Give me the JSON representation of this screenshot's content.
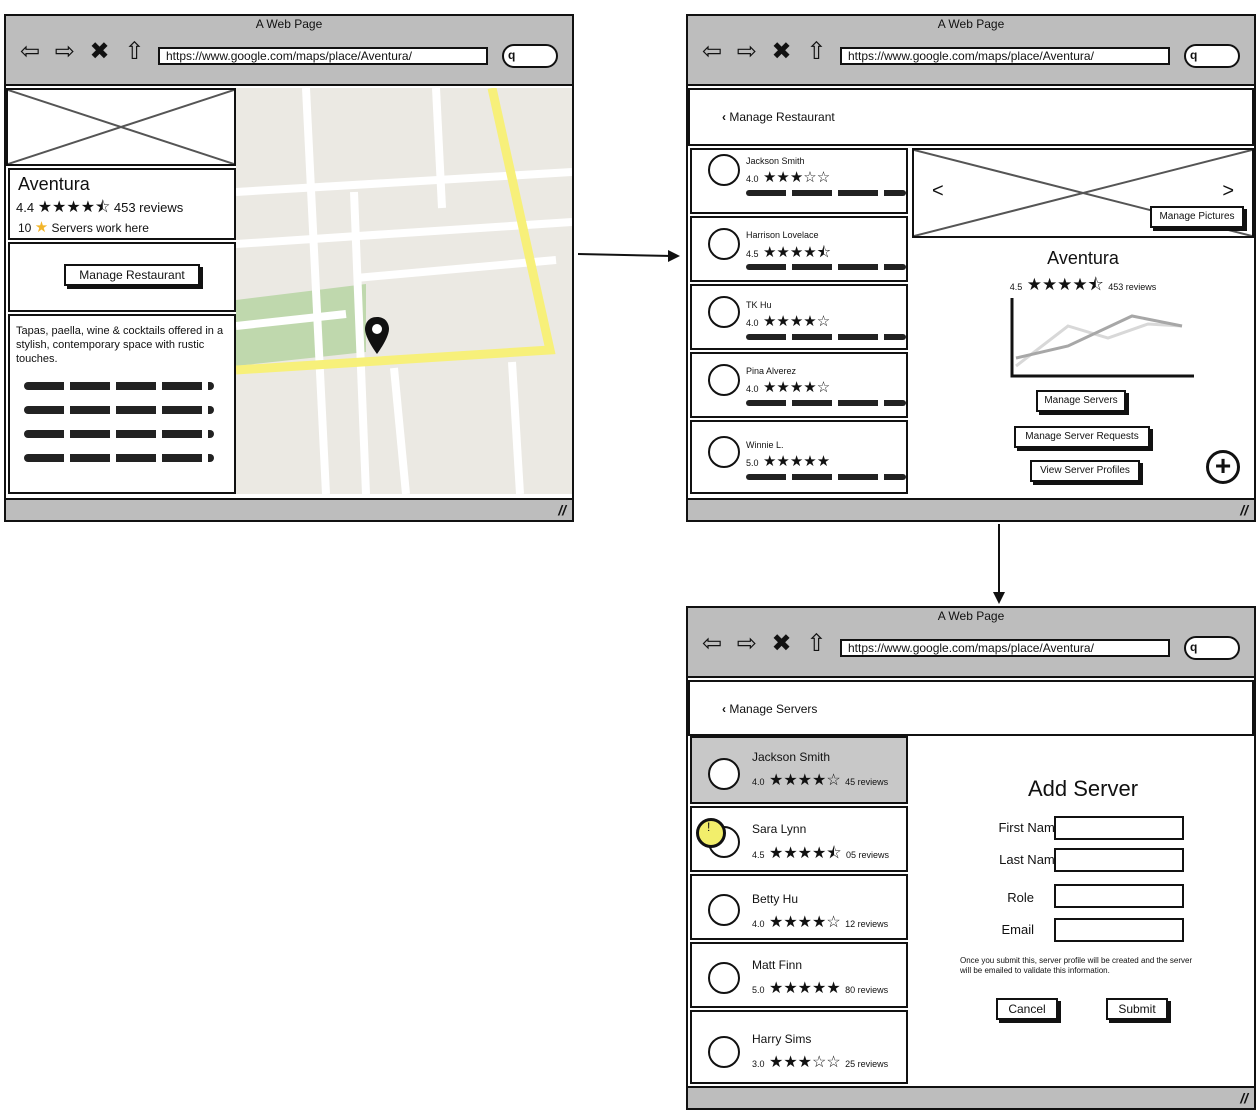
{
  "browser": {
    "title": "A Web Page",
    "url": "https://www.google.com/maps/place/Aventura/",
    "nav_icons": "⇦ ⇨ ✖ ⇧",
    "search_glyph": "q",
    "resize_glyph": "//"
  },
  "screen1": {
    "restaurant_name": "Aventura",
    "rating": "4.4",
    "stars": "★★★★⯪",
    "reviews": "453 reviews",
    "servers_count": "10",
    "servers_star": "★",
    "servers_text": "Servers work here",
    "manage_button": "Manage Restaurant",
    "description": "Tapas, paella, wine & cocktails offered in a stylish, contemporary space with rustic touches.",
    "pin_icon": "map-pin-icon"
  },
  "screen2": {
    "back_label": "Manage Restaurant",
    "servers": [
      {
        "name": "Jackson Smith",
        "rating": "4.0",
        "stars": "★★★☆☆"
      },
      {
        "name": "Harrison Lovelace",
        "rating": "4.5",
        "stars": "★★★★⯪"
      },
      {
        "name": "TK Hu",
        "rating": "4.0",
        "stars": "★★★★☆"
      },
      {
        "name": "Pina Alverez",
        "rating": "4.0",
        "stars": "★★★★☆"
      },
      {
        "name": "Winnie L.",
        "rating": "5.0",
        "stars": "★★★★★"
      }
    ],
    "manage_pictures": "Manage Pictures",
    "prev_glyph": "<",
    "next_glyph": ">",
    "restaurant_name": "Aventura",
    "rating": "4.5",
    "stars": "★★★★⯪",
    "reviews": "453 reviews",
    "manage_servers": "Manage Servers",
    "manage_requests": "Manage Server Requests",
    "view_profiles": "View Server Profiles",
    "add_glyph": "+"
  },
  "screen3": {
    "back_label": "Manage Servers",
    "servers": [
      {
        "name": "Jackson Smith",
        "rating": "4.0",
        "stars": "★★★★☆",
        "reviews": "45 reviews",
        "selected": true
      },
      {
        "name": "Sara Lynn",
        "rating": "4.5",
        "stars": "★★★★⯪",
        "reviews": "05 reviews",
        "selected": false
      },
      {
        "name": "Betty Hu",
        "rating": "4.0",
        "stars": "★★★★☆",
        "reviews": "12 reviews",
        "selected": false
      },
      {
        "name": "Matt Finn",
        "rating": "5.0",
        "stars": "★★★★★",
        "reviews": "80 reviews",
        "selected": false
      },
      {
        "name": "Harry Sims",
        "rating": "3.0",
        "stars": "★★★☆☆",
        "reviews": "25 reviews",
        "selected": false
      }
    ],
    "alert_glyph": "!",
    "form_title": "Add Server",
    "fields": [
      {
        "label": "First Name",
        "value": ""
      },
      {
        "label": "Last Name",
        "value": ""
      },
      {
        "label": "Role",
        "value": ""
      },
      {
        "label": "Email",
        "value": ""
      }
    ],
    "notice": "Once you submit this, server profile will be created and the server will be emailed to validate this information.",
    "cancel": "Cancel",
    "submit": "Submit"
  },
  "colors": {
    "chrome": "#bdbdbd",
    "map_bg": "#ebe9e3",
    "road_major": "#f7f07a",
    "park": "#bfd8ad",
    "highlight": "#f2ee6b",
    "selected_row": "#c8c8c8"
  }
}
